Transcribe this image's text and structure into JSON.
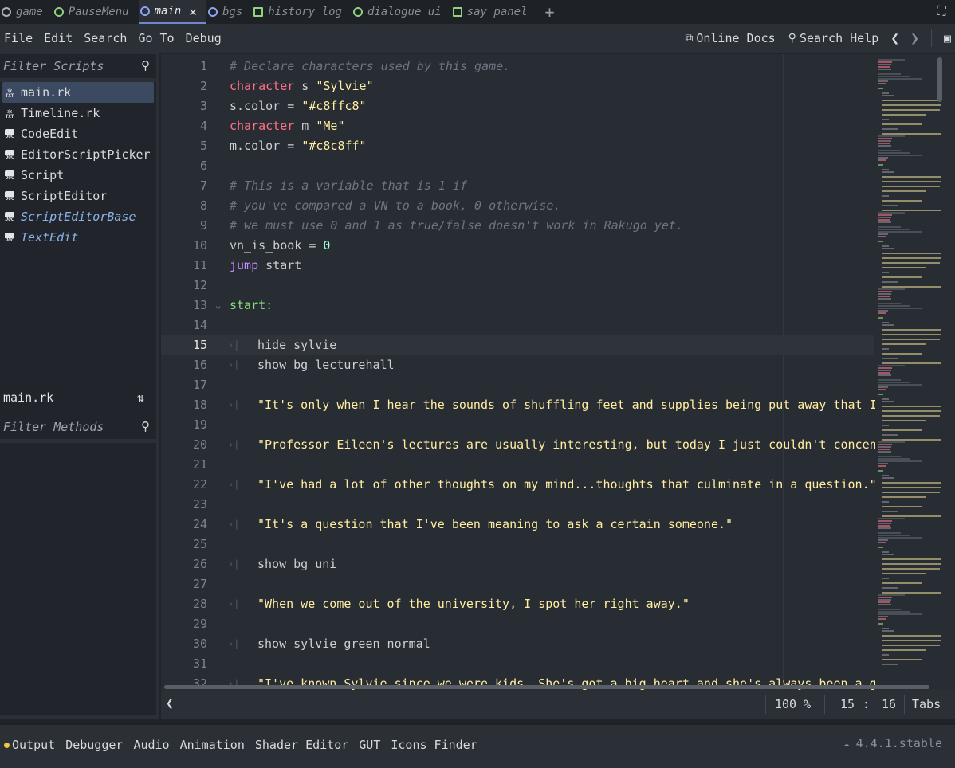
{
  "tabs": [
    {
      "label": "game",
      "icon": "scene-icon",
      "active": false
    },
    {
      "label": "PauseMenu",
      "icon": "scene-icon",
      "active": false
    },
    {
      "label": "main",
      "icon": "scene-icon",
      "active": true
    },
    {
      "label": "bgs",
      "icon": "scene-icon",
      "active": false
    },
    {
      "label": "history_log",
      "icon": "control-scene-icon",
      "active": false
    },
    {
      "label": "dialogue_ui",
      "icon": "scene-icon",
      "active": false
    },
    {
      "label": "say_panel",
      "icon": "control-scene-icon",
      "active": false
    }
  ],
  "menu": {
    "items": [
      "File",
      "Edit",
      "Search",
      "Go To",
      "Debug"
    ],
    "online_docs": "Online Docs",
    "search_help": "Search Help"
  },
  "left": {
    "filter_scripts_placeholder": "Filter Scripts",
    "scripts": [
      {
        "name": "main.rk",
        "icon": "text-file-icon",
        "selected": true,
        "inherited": false
      },
      {
        "name": "Timeline.rk",
        "icon": "text-file-icon",
        "selected": false,
        "inherited": false
      },
      {
        "name": "CodeEdit",
        "icon": "doc-icon",
        "selected": false,
        "inherited": false
      },
      {
        "name": "EditorScriptPicker",
        "icon": "doc-icon",
        "selected": false,
        "inherited": false
      },
      {
        "name": "Script",
        "icon": "doc-icon",
        "selected": false,
        "inherited": false
      },
      {
        "name": "ScriptEditor",
        "icon": "doc-icon",
        "selected": false,
        "inherited": false
      },
      {
        "name": "ScriptEditorBase",
        "icon": "doc-icon",
        "selected": false,
        "inherited": true
      },
      {
        "name": "TextEdit",
        "icon": "doc-icon",
        "selected": false,
        "inherited": true
      }
    ],
    "current_file": "main.rk",
    "filter_methods_placeholder": "Filter Methods"
  },
  "editor": {
    "current_line": 15,
    "lines": [
      {
        "n": "1",
        "indent": false,
        "fold": false,
        "tokens": [
          [
            "# Declare characters used by this game.",
            "comment"
          ]
        ]
      },
      {
        "n": "2",
        "indent": false,
        "fold": false,
        "tokens": [
          [
            "character",
            "keyword"
          ],
          [
            " s ",
            "plain"
          ],
          [
            "\"Sylvie\"",
            "string"
          ]
        ]
      },
      {
        "n": "3",
        "indent": false,
        "fold": false,
        "tokens": [
          [
            "s.color = ",
            "plain"
          ],
          [
            "\"#c8ffc8\"",
            "string"
          ]
        ]
      },
      {
        "n": "4",
        "indent": false,
        "fold": false,
        "tokens": [
          [
            "character",
            "keyword"
          ],
          [
            " m ",
            "plain"
          ],
          [
            "\"Me\"",
            "string"
          ]
        ]
      },
      {
        "n": "5",
        "indent": false,
        "fold": false,
        "tokens": [
          [
            "m.color = ",
            "plain"
          ],
          [
            "\"#c8c8ff\"",
            "string"
          ]
        ]
      },
      {
        "n": "6",
        "indent": false,
        "fold": false,
        "tokens": []
      },
      {
        "n": "7",
        "indent": false,
        "fold": false,
        "tokens": [
          [
            "# This is a variable that is 1 if",
            "comment"
          ]
        ]
      },
      {
        "n": "8",
        "indent": false,
        "fold": false,
        "tokens": [
          [
            "# you've compared a VN to a book, 0 otherwise.",
            "comment"
          ]
        ]
      },
      {
        "n": "9",
        "indent": false,
        "fold": false,
        "tokens": [
          [
            "# we must use 0 and 1 as true/false doesn't work in Rakugo yet.",
            "comment"
          ]
        ]
      },
      {
        "n": "10",
        "indent": false,
        "fold": false,
        "tokens": [
          [
            "vn_is_book = ",
            "plain"
          ],
          [
            "0",
            "number"
          ]
        ]
      },
      {
        "n": "11",
        "indent": false,
        "fold": false,
        "tokens": [
          [
            "jump",
            "ctrl"
          ],
          [
            " start",
            "plain"
          ]
        ]
      },
      {
        "n": "12",
        "indent": false,
        "fold": false,
        "tokens": []
      },
      {
        "n": "13",
        "indent": false,
        "fold": true,
        "tokens": [
          [
            "start:",
            "label"
          ]
        ]
      },
      {
        "n": "14",
        "indent": false,
        "fold": false,
        "tokens": []
      },
      {
        "n": "15",
        "indent": true,
        "fold": false,
        "tokens": [
          [
            "hide sylvie",
            "plain"
          ]
        ]
      },
      {
        "n": "16",
        "indent": true,
        "fold": false,
        "tokens": [
          [
            "show bg lecturehall",
            "plain"
          ]
        ]
      },
      {
        "n": "17",
        "indent": false,
        "fold": false,
        "tokens": []
      },
      {
        "n": "18",
        "indent": true,
        "fold": false,
        "tokens": [
          [
            "\"It's only when I hear the sounds of shuffling feet and supplies being put away that I re",
            "string"
          ]
        ]
      },
      {
        "n": "19",
        "indent": false,
        "fold": false,
        "tokens": []
      },
      {
        "n": "20",
        "indent": true,
        "fold": false,
        "tokens": [
          [
            "\"Professor Eileen's lectures are usually interesting, but today I just couldn't concentra",
            "string"
          ]
        ]
      },
      {
        "n": "21",
        "indent": false,
        "fold": false,
        "tokens": []
      },
      {
        "n": "22",
        "indent": true,
        "fold": false,
        "tokens": [
          [
            "\"I've had a lot of other thoughts on my mind...thoughts that culminate in a question.\"",
            "string"
          ]
        ]
      },
      {
        "n": "23",
        "indent": false,
        "fold": false,
        "tokens": []
      },
      {
        "n": "24",
        "indent": true,
        "fold": false,
        "tokens": [
          [
            "\"It's a question that I've been meaning to ask a certain someone.\"",
            "string"
          ]
        ]
      },
      {
        "n": "25",
        "indent": false,
        "fold": false,
        "tokens": []
      },
      {
        "n": "26",
        "indent": true,
        "fold": false,
        "tokens": [
          [
            "show bg uni",
            "plain"
          ]
        ]
      },
      {
        "n": "27",
        "indent": false,
        "fold": false,
        "tokens": []
      },
      {
        "n": "28",
        "indent": true,
        "fold": false,
        "tokens": [
          [
            "\"When we come out of the university, I spot her right away.\"",
            "string"
          ]
        ]
      },
      {
        "n": "29",
        "indent": false,
        "fold": false,
        "tokens": []
      },
      {
        "n": "30",
        "indent": true,
        "fold": false,
        "tokens": [
          [
            "show sylvie green normal",
            "plain"
          ]
        ]
      },
      {
        "n": "31",
        "indent": false,
        "fold": false,
        "tokens": []
      },
      {
        "n": "32",
        "indent": true,
        "fold": false,
        "tokens": [
          [
            "\"I've known Sylvie since we were kids. She's got a big heart and she's always been a good",
            "string"
          ]
        ]
      }
    ],
    "zoom": "100 %",
    "cursor_line": "15",
    "cursor_sep": ":",
    "cursor_col": "16",
    "indent_mode": "Tabs"
  },
  "bottom": {
    "tabs": [
      "Output",
      "Debugger",
      "Audio",
      "Animation",
      "Shader Editor",
      "GUT",
      "Icons Finder"
    ],
    "version": "4.4.1.stable"
  },
  "colors": {
    "comment": "#6c7680",
    "keyword": "#ff7085",
    "string": "#ffeda1",
    "number": "#a1ffe0",
    "control_flow": "#c78bff",
    "label": "#88e07a",
    "selection": "#3b4a61",
    "warning_dot": "#f0c741"
  }
}
